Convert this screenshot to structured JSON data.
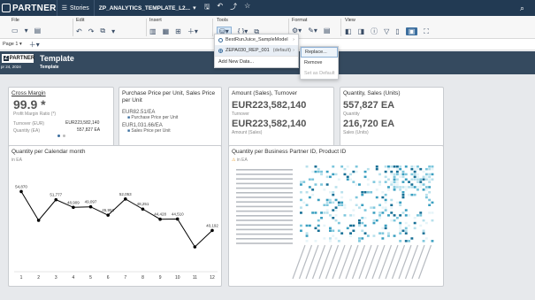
{
  "topbar": {
    "logo": "PARTNER",
    "stories": "Stories",
    "title": "ZP_ANALYTICS_TEMPLATE_L2...",
    "icons": [
      "save-icon",
      "undo-icon",
      "share-icon",
      "star-icon"
    ]
  },
  "ribbon": {
    "groups": [
      "File",
      "Edit",
      "Insert",
      "Tools",
      "Format",
      "View"
    ]
  },
  "pagebar": {
    "page": "Page 1"
  },
  "header": {
    "logo_z": "Z",
    "logo": "PARTNER",
    "date": "pr 24, 2024",
    "title": "Template",
    "subtitle": "Template"
  },
  "cards": {
    "cross_margin": {
      "title": "Cross Margin",
      "value": "99.9 *",
      "sub": "Profit Margin Ratio (*)",
      "row1_label": "Turnover (EUR)",
      "row1_value": "EUR223,582,140",
      "row2_label": "Quantity (EA)",
      "row2_value": "557,827 EA"
    },
    "purchase_price": {
      "title": "Purchase Price per Unit, Sales Price per Unit",
      "v1": "EUR82.51/EA",
      "l1": "Purchase Price per Unit",
      "v2": "EUR1,031.66/EA",
      "l2": "Sales Price per Unit"
    },
    "amount": {
      "title": "Amount (Sales), Turnover",
      "v1": "EUR223,582,140",
      "l1": "Turnover",
      "v2": "EUR223,582,140",
      "l2": "Amount (Sales)"
    },
    "quantity": {
      "title": "Quantity, Sales (Units)",
      "v1": "557,827 EA",
      "l1": "Quantity",
      "v2": "216,720 EA",
      "l2": "Sales (Units)"
    },
    "qty_month": {
      "title": "Quantity per Calendar month",
      "unit": "in EA"
    },
    "qty_bp": {
      "title": "Quantity per Business Partner ID, Product ID",
      "unit": "in EA"
    }
  },
  "chart_data": {
    "type": "line",
    "title": "Quantity per Calendar month",
    "categories": [
      "1",
      "2",
      "3",
      "4",
      "5",
      "6",
      "7",
      "8",
      "9",
      "10",
      "11",
      "12"
    ],
    "values": [
      54870,
      44000,
      51777,
      48909,
      49097,
      45953,
      52053,
      48251,
      44428,
      44510,
      34000,
      40192
    ],
    "labels": [
      "54,870",
      "",
      "51,777",
      "48,909",
      "49,097",
      "45,953",
      "52,053",
      "48,251",
      "44,428",
      "44,510",
      "",
      "40,192"
    ],
    "ylim": [
      30000,
      60000
    ]
  },
  "tools_menu": {
    "items": [
      {
        "label": "BestRunJuice_SampleModel",
        "selected": false
      },
      {
        "label": "ZEPA030_REP_001",
        "suffix": "(default)",
        "selected": true
      },
      {
        "label": "Add New Data..."
      }
    ]
  },
  "sub_menu": {
    "items": [
      "Replace...",
      "Remove",
      "Set as Default"
    ]
  }
}
